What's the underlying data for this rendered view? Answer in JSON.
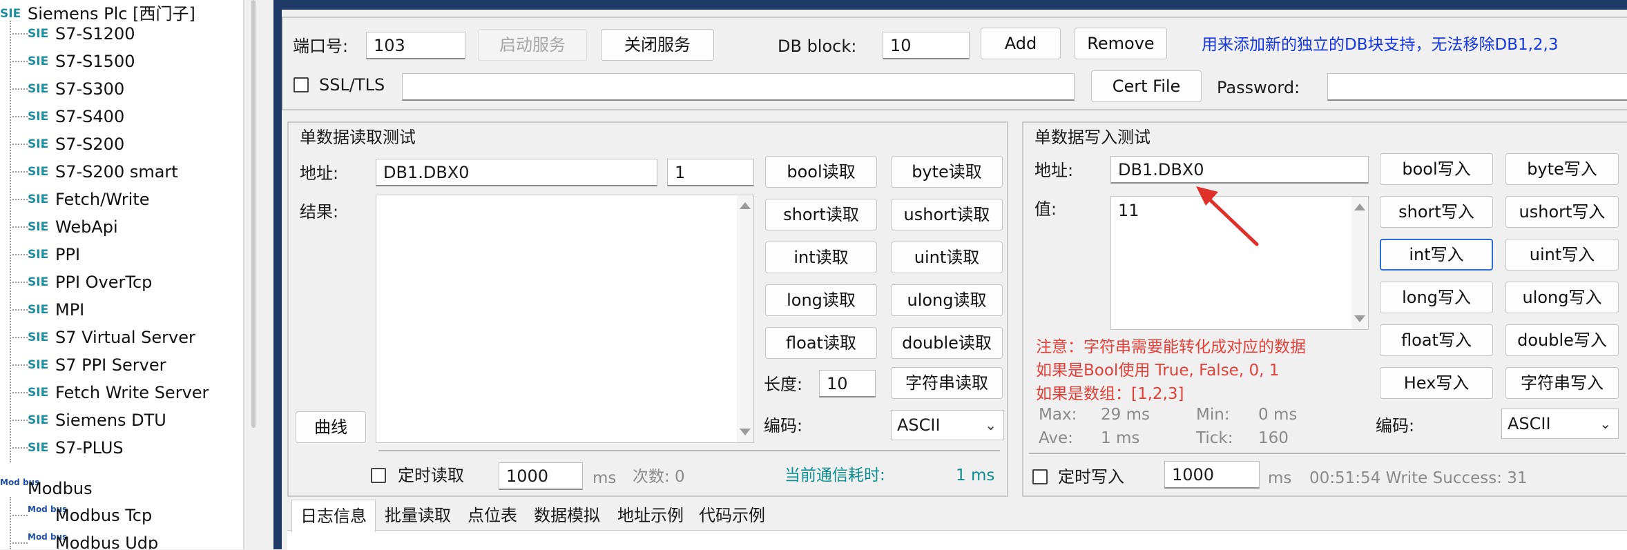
{
  "tree": {
    "siemens_root": "Siemens Plc [西门子]",
    "siemens_icon_text": "SIE",
    "siemens_items": [
      "S7-S1200",
      "S7-S1500",
      "S7-S300",
      "S7-S400",
      "S7-S200",
      "S7-S200 smart",
      "Fetch/Write",
      "WebApi",
      "PPI",
      "PPI OverTcp",
      "MPI",
      "S7 Virtual Server",
      "S7 PPI Server",
      "Fetch Write Server",
      "Siemens DTU",
      "S7-PLUS"
    ],
    "modbus_root": "Modbus",
    "modbus_icon_text": "Mod bus",
    "modbus_items": [
      "Modbus Tcp",
      "Modbus Udp"
    ]
  },
  "server": {
    "port_label": "端口号:",
    "port_value": "103",
    "start_label": "启动服务",
    "stop_label": "关闭服务",
    "db_label": "DB block:",
    "db_value": "10",
    "add_label": "Add",
    "remove_label": "Remove",
    "hint": "用来添加新的独立的DB块支持，无法移除DB1,2,3",
    "ssl_label": "SSL/TLS",
    "cert_label": "Cert File",
    "password_label": "Password:"
  },
  "read": {
    "title": "单数据读取测试",
    "addr_label": "地址:",
    "addr_value": "DB1.DBX0",
    "count_value": "1",
    "result_label": "结果:",
    "curve_label": "曲线",
    "buttons": [
      "bool读取",
      "byte读取",
      "short读取",
      "ushort读取",
      "int读取",
      "uint读取",
      "long读取",
      "ulong读取",
      "float读取",
      "double读取"
    ],
    "length_label": "长度:",
    "length_value": "10",
    "string_read": "字符串读取",
    "encoding_label": "编码:",
    "encoding_value": "ASCII",
    "timer_label": "定时读取",
    "timer_value": "1000",
    "ms": "ms",
    "count_label": "次数: 0",
    "comm_label": "当前通信耗时:",
    "comm_value": "1 ms"
  },
  "write": {
    "title": "单数据写入测试",
    "addr_label": "地址:",
    "addr_value": "DB1.DBX0",
    "value_label": "值:",
    "value_text": "11",
    "notes": [
      "注意：字符串需要能转化成对应的数据",
      "如果是Bool使用 True, False, 0, 1",
      "如果是数组：[1,2,3]"
    ],
    "max_label": "Max:",
    "max_value": "29 ms",
    "min_label": "Min:",
    "min_value": "0 ms",
    "ave_label": "Ave:",
    "ave_value": "1 ms",
    "tick_label": "Tick:",
    "tick_value": "160",
    "buttons": [
      "bool写入",
      "byte写入",
      "short写入",
      "ushort写入",
      "int写入",
      "uint写入",
      "long写入",
      "ulong写入",
      "float写入",
      "double写入",
      "Hex写入",
      "字符串写入"
    ],
    "encoding_label": "编码:",
    "encoding_value": "ASCII",
    "timer_label": "定时写入",
    "timer_value": "1000",
    "ms": "ms",
    "status": "00:51:54 Write Success: 31"
  },
  "tabs": [
    "日志信息",
    "批量读取",
    "点位表",
    "数据模拟",
    "地址示例",
    "代码示例"
  ],
  "colors": {
    "accent_blue": "#1738e0",
    "note_red": "#e0413a",
    "teal": "#0f8f8f",
    "focus": "#2b6fd6",
    "arrow_red": "#e0302a"
  }
}
